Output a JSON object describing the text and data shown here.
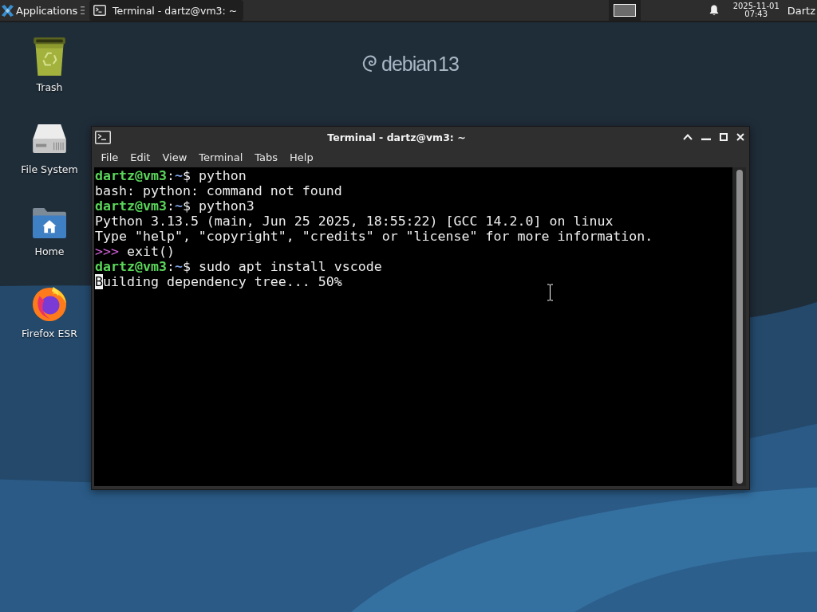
{
  "top_panel": {
    "applications_label": "Applications",
    "tasks": [
      {
        "title": "Terminal - dartz@vm3: ~",
        "selected": true
      }
    ],
    "date": "2025-11-01",
    "time": "07:43",
    "user": "Dartz"
  },
  "wallpaper": {
    "logo_text": "debian 13"
  },
  "desktop_icons": [
    {
      "kind": "trash",
      "label": "Trash"
    },
    {
      "kind": "drive",
      "label": "File System"
    },
    {
      "kind": "home",
      "label": "Home"
    },
    {
      "kind": "browser",
      "label": "Firefox ESR"
    }
  ],
  "terminal": {
    "title": "Terminal - dartz@vm3: ~",
    "menu": [
      "File",
      "Edit",
      "View",
      "Terminal",
      "Tabs",
      "Help"
    ],
    "lines": [
      {
        "cursor": false,
        "segments": [
          {
            "kind": "user",
            "text": "dartz@vm3"
          },
          {
            "kind": "plain",
            "text": ":"
          },
          {
            "kind": "path",
            "text": "~"
          },
          {
            "kind": "plain",
            "text": "$ python"
          }
        ]
      },
      {
        "cursor": false,
        "segments": [
          {
            "kind": "plain",
            "text": "bash: python: command not found"
          }
        ]
      },
      {
        "cursor": false,
        "segments": [
          {
            "kind": "user",
            "text": "dartz@vm3"
          },
          {
            "kind": "plain",
            "text": ":"
          },
          {
            "kind": "path",
            "text": "~"
          },
          {
            "kind": "plain",
            "text": "$ python3"
          }
        ]
      },
      {
        "cursor": false,
        "segments": [
          {
            "kind": "plain",
            "text": "Python 3.13.5 (main, Jun 25 2025, 18:55:22) [GCC 14.2.0] on linux"
          }
        ]
      },
      {
        "cursor": false,
        "segments": [
          {
            "kind": "plain",
            "text": "Type \"help\", \"copyright\", \"credits\" or \"license\" for more information."
          }
        ]
      },
      {
        "cursor": false,
        "segments": [
          {
            "kind": "repl",
            "text": ">>>"
          },
          {
            "kind": "plain",
            "text": " exit()"
          }
        ]
      },
      {
        "cursor": false,
        "segments": [
          {
            "kind": "user",
            "text": "dartz@vm3"
          },
          {
            "kind": "plain",
            "text": ":"
          },
          {
            "kind": "path",
            "text": "~"
          },
          {
            "kind": "plain",
            "text": "$ sudo apt install vscode"
          }
        ]
      },
      {
        "cursor": true,
        "segments": [
          {
            "kind": "plain",
            "text": "Building dependency tree... 50%"
          }
        ]
      }
    ]
  }
}
